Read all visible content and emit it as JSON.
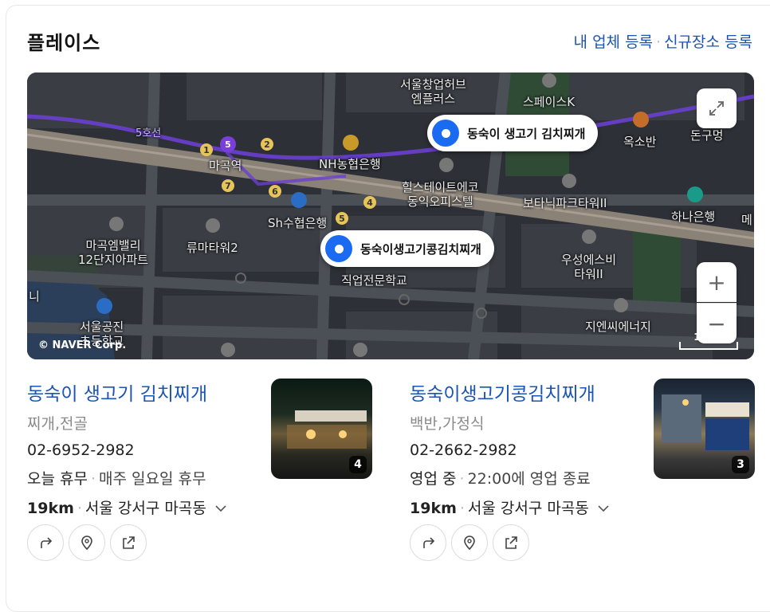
{
  "header": {
    "title": "플레이스",
    "link_register": "내 업체 등록",
    "link_new_place": "신규장소 등록"
  },
  "map": {
    "pins": [
      "동숙이 생고기 김치찌개",
      "동숙이생고기콩김치찌개"
    ],
    "labels": {
      "l1": "서울창업허브\n엠플러스",
      "l2": "스페이스K",
      "l3": "5호선",
      "l4": "마곡역",
      "l5": "NH농협은행",
      "l6": "힐스테이트에코\n동익오피스텔",
      "l7": "보타닉파크타워II",
      "l8": "옥소반",
      "l9": "돈구멍",
      "l10": "하나은행",
      "l11": "Sh수협은행",
      "l12": "류마타워2",
      "l13": "마곡엠밸리\n12단지아파트",
      "l14": "우성에스비\n타워II",
      "l15": "직업전문학교",
      "l16": "지엔씨에너지",
      "l17": "서울공진\n초등학교",
      "l18": "메",
      "l19": "니"
    },
    "copyright": "© NAVER Corp.",
    "scale": "100m",
    "zoom_in": "+",
    "zoom_out": "−"
  },
  "places": [
    {
      "name": "동숙이 생고기 김치찌개",
      "category": "찌개,전골",
      "phone": "02-6952-2982",
      "status": "오늘 휴무",
      "status_detail": "매주 일요일 휴무",
      "distance": "19km",
      "address": "서울 강서구 마곡동",
      "photo_count": "4"
    },
    {
      "name": "동숙이생고기콩김치찌개",
      "category": "백반,가정식",
      "phone": "02-2662-2982",
      "status": "영업 중",
      "status_detail": "22:00에 영업 종료",
      "distance": "19km",
      "address": "서울 강서구 마곡동",
      "photo_count": "3"
    }
  ],
  "icons": {
    "directions": "directions-icon",
    "save": "location-pin-icon",
    "share": "share-icon"
  }
}
